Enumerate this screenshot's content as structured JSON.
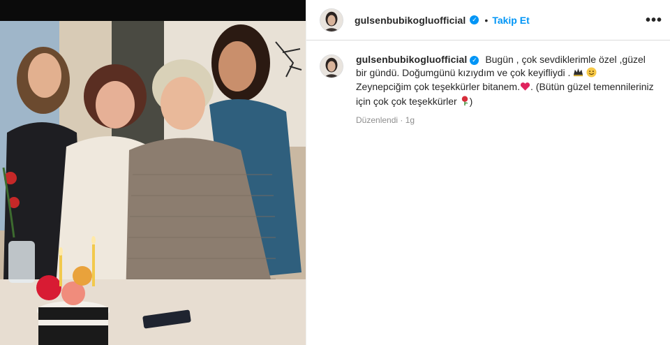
{
  "post": {
    "username": "gulsenbubikogluofficial",
    "follow_label": "Takip Et",
    "separator": "•",
    "more_label": "•••"
  },
  "caption": {
    "username": "gulsenbubikogluofficial",
    "text_part1": "Bugün , çok sevdiklerimle özel ,güzel bir gündü. Doğumgünü kızıydım ve çok keyifliydi .",
    "text_part2": "Zeynepciğim çok teşekkürler bitanem.",
    "text_part3": ". (Bütün güzel temennileriniz için çok çok teşekkürler",
    "text_part4": ")",
    "edited_label": "Düzenlendi",
    "meta_separator": "·",
    "time_ago": "1g"
  },
  "colors": {
    "accent_blue": "#0095f6",
    "text": "#262626",
    "muted": "#8e8e8e",
    "border": "#dbdbdb"
  },
  "icons": [
    "verified-badge-icon",
    "more-options-icon",
    "crown-emoji-icon",
    "smile-emoji-icon",
    "red-heart-emoji-icon",
    "rose-emoji-icon"
  ]
}
